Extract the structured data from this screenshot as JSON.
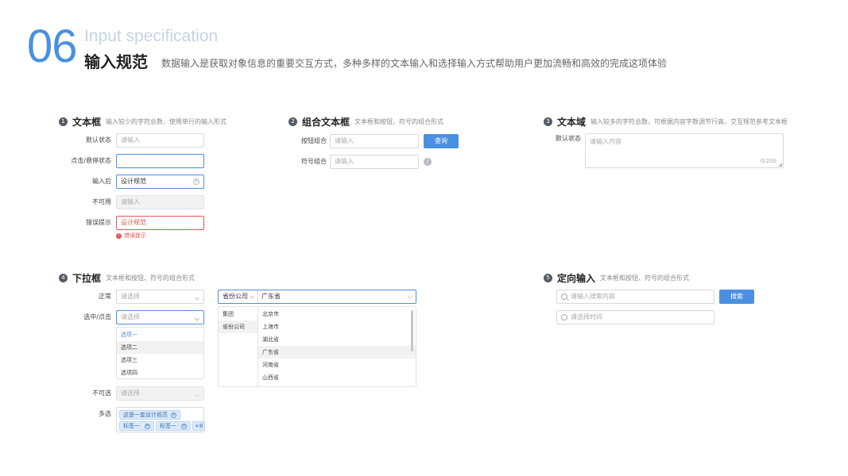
{
  "header": {
    "number": "06",
    "english": "Input specification",
    "title": "输入规范",
    "description": "数据输入是获取对象信息的重要交互方式，多种多样的文本输入和选择输入方式帮助用户更加流畅和高效的完成这项体验"
  },
  "colors": {
    "accent": "#4a90e2",
    "error": "#e55353",
    "badge": "#555c66"
  },
  "s1": {
    "badge": "1",
    "name": "文本框",
    "sub": "输入较少的字符总数，使用单行的输入形式",
    "rows": [
      {
        "label": "默认状态",
        "value": "请输入"
      },
      {
        "label": "点击/悬停状态",
        "value": ""
      },
      {
        "label": "输入后",
        "value": "设计规范"
      },
      {
        "label": "不可用",
        "value": "请输入"
      },
      {
        "label": "错误提示",
        "value": "设计规范"
      }
    ],
    "error_msg": "错误提示"
  },
  "s2": {
    "badge": "2",
    "name": "组合文本框",
    "sub": "文本框和按钮、符号的组合形式",
    "rows": [
      {
        "label": "按钮组合",
        "placeholder": "请输入",
        "button": "查询"
      },
      {
        "label": "符号组合",
        "placeholder": "请输入",
        "help": "?"
      }
    ]
  },
  "s3": {
    "badge": "3",
    "name": "文本域",
    "sub": "输入较多的字符总数，可根据内容字数调节行高，交互规范参考文本框",
    "label": "默认状态",
    "placeholder": "请输入内容",
    "counter": "0/200"
  },
  "s4": {
    "badge": "4",
    "name": "下拉框",
    "sub": "文本框和按钮、符号的组合形式",
    "normal_label": "正常",
    "normal_value": "请选择",
    "select_label": "选中/点击",
    "select_value": "请选择",
    "options": [
      "选项一",
      "选项二",
      "选项三",
      "选项四"
    ],
    "disabled_label": "不可选",
    "disabled_value": "请选择",
    "multi_label": "多选",
    "tags": [
      "这是一套设计规范",
      "标签一",
      "标签一"
    ],
    "more": "+8",
    "cascade": {
      "left_value": "省份公司",
      "right_value": "广东省",
      "left_items": [
        "集团",
        "省份公司"
      ],
      "right_items": [
        "北京市",
        "上海市",
        "湖北省",
        "广东省",
        "河南省",
        "山西省"
      ]
    }
  },
  "s5": {
    "badge": "5",
    "name": "定向输入",
    "sub": "文本框和按钮、符号的组合形式",
    "search_placeholder": "请输入搜索内容",
    "search_button": "搜索",
    "time_placeholder": "请选择时间"
  }
}
